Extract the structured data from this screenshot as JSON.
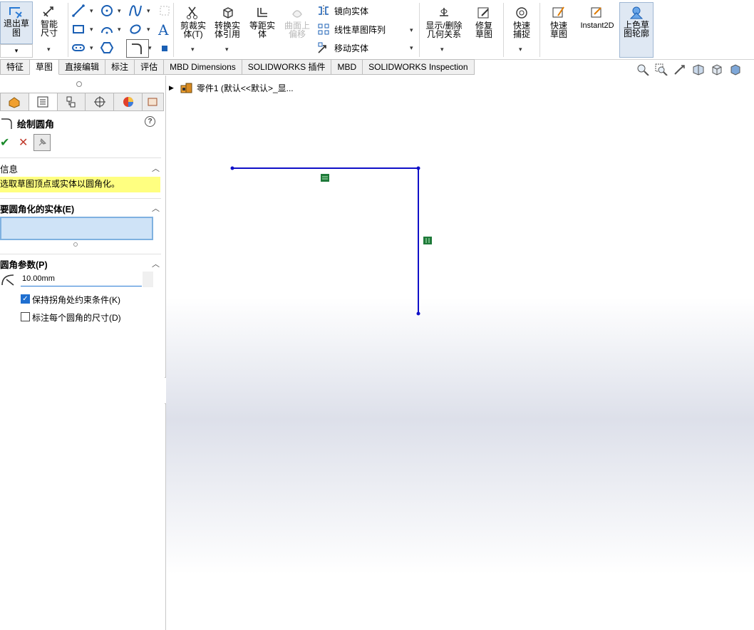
{
  "ribbon": {
    "exit_sketch": "退出草图",
    "smart_dim": "智能尺寸",
    "trim": "剪裁实体(T)",
    "convert": "转换实体引用",
    "offset": "等距实体",
    "surface_offset": "曲面上偏移",
    "mirror": "镜向实体",
    "linear_pattern": "线性草图阵列",
    "move": "移动实体",
    "show_delete_relations": "显示/删除几何关系",
    "repair": "修复草图",
    "quick_snap": "快速捕捉",
    "rapid_sketch": "快速草图",
    "instant2d": "Instant2D",
    "shaded_sketch": "上色草图轮廓"
  },
  "tabs": [
    "特征",
    "草图",
    "直接编辑",
    "标注",
    "评估",
    "MBD Dimensions",
    "SOLIDWORKS 插件",
    "MBD",
    "SOLIDWORKS Inspection"
  ],
  "active_tab": "草图",
  "feature_tree": {
    "root": "零件1  (默认<<默认>_显..."
  },
  "panel": {
    "title": "绘制圆角",
    "info_header": "信息",
    "info_text": "选取草图顶点或实体以圆角化。",
    "entities_header": "要圆角化的实体(E)",
    "params_header": "圆角参数(P)",
    "radius_value": "10.00mm",
    "keep_constraints": "保持拐角处约束条件(K)",
    "keep_constraints_checked": true,
    "dimension_each": "标注每个圆角的尺寸(D)",
    "dimension_each_checked": false
  },
  "colors": {
    "sketch_line": "#1010c8",
    "relation_icon": "#1f7a3a",
    "info_bg": "#ffff80",
    "selection_box": "#cfe3f7"
  }
}
